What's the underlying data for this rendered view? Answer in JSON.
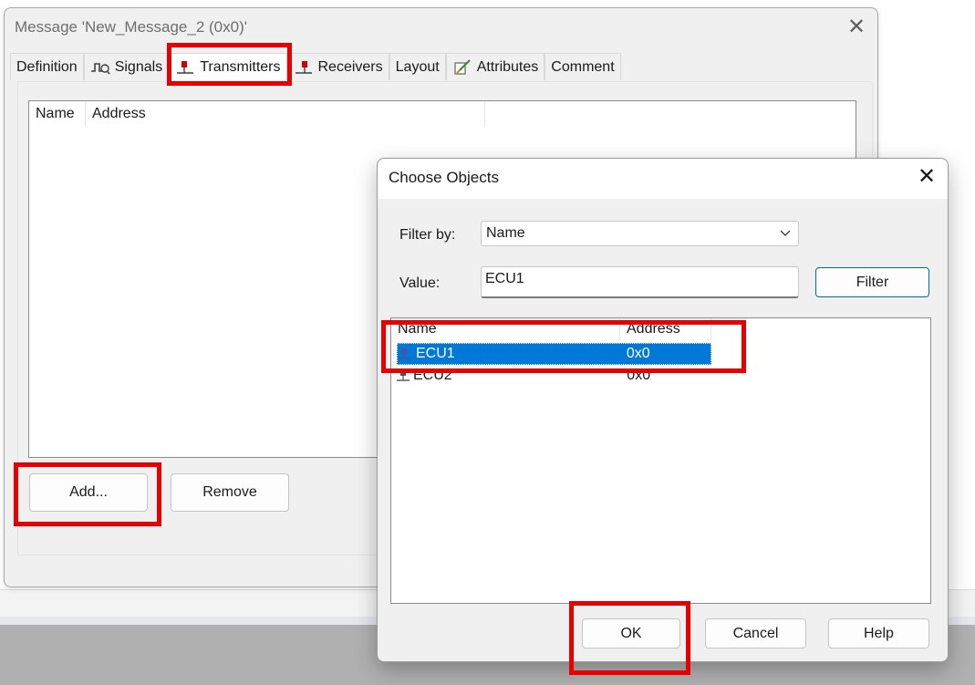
{
  "message_dialog": {
    "title": "Message 'New_Message_2 (0x0)'",
    "close_glyph": "✕",
    "tabs": [
      {
        "label": "Definition",
        "icon": null
      },
      {
        "label": "Signals",
        "icon": "signals-icon"
      },
      {
        "label": "Transmitters",
        "icon": "transmitter-icon"
      },
      {
        "label": "Receivers",
        "icon": "receiver-icon"
      },
      {
        "label": "Layout",
        "icon": null
      },
      {
        "label": "Attributes",
        "icon": "attributes-icon"
      },
      {
        "label": "Comment",
        "icon": null
      }
    ],
    "active_tab": "Transmitters",
    "list": {
      "columns": [
        "Name",
        "Address"
      ],
      "rows": []
    },
    "add_button": "Add...",
    "remove_button": "Remove"
  },
  "choose_objects": {
    "title": "Choose Objects",
    "close_glyph": "✕",
    "filter_by_label": "Filter by:",
    "filter_by_value": "Name",
    "value_label": "Value:",
    "value_input": "ECU1",
    "filter_button": "Filter",
    "list": {
      "columns": [
        "Name",
        "Address"
      ],
      "rows": [
        {
          "name": "ECU1",
          "address": "0x0",
          "selected": true
        },
        {
          "name": "ECU2",
          "address": "0x0",
          "selected": false
        }
      ]
    },
    "ok_button": "OK",
    "cancel_button": "Cancel",
    "help_button": "Help"
  },
  "colors": {
    "highlight": "#e60000",
    "selection": "#0078d7",
    "accent_border": "#0067c0"
  }
}
